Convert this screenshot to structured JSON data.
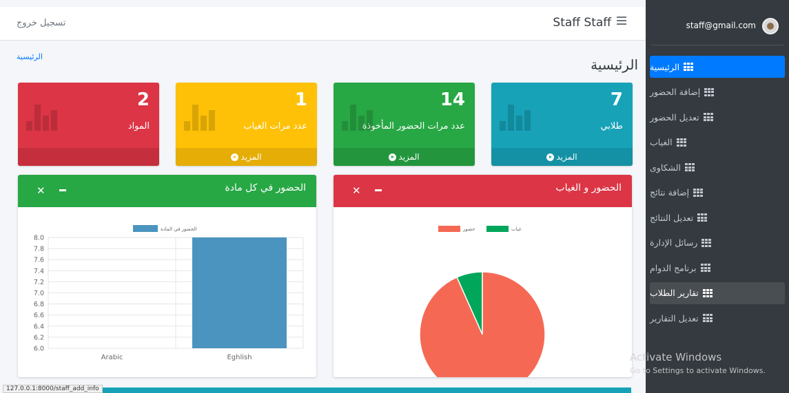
{
  "navbar": {
    "logout_label": "تسجيل خروج",
    "user_name": "Staff Staff",
    "menu_icon": "hamburger-icon"
  },
  "sidebar": {
    "email": "staff@gmail.com",
    "items": [
      {
        "label": "الرئيسية",
        "state": "active"
      },
      {
        "label": "إضافة الحضور",
        "state": ""
      },
      {
        "label": "تعديل الحضور",
        "state": ""
      },
      {
        "label": "الغياب",
        "state": ""
      },
      {
        "label": "الشكاوى",
        "state": ""
      },
      {
        "label": "إضافة نتائج",
        "state": ""
      },
      {
        "label": "تعديل النتائج",
        "state": ""
      },
      {
        "label": "رسائل الإدارة",
        "state": ""
      },
      {
        "label": "برنامج الدوام",
        "state": ""
      },
      {
        "label": "تقارير الطلاب",
        "state": "hover"
      },
      {
        "label": "تعديل التقارير",
        "state": ""
      }
    ]
  },
  "header": {
    "title": "الرئيسية",
    "breadcrumb": "الرئيسية"
  },
  "boxes": [
    {
      "value": "7",
      "label": "طلابي",
      "more": "المزيد",
      "color": "#17a2b8"
    },
    {
      "value": "14",
      "label": "عدد مرات الحضور المأخوذة",
      "more": "المزيد",
      "color": "#28a745"
    },
    {
      "value": "1",
      "label": "عدد مرات الغياب",
      "more": "المزيد",
      "color": "#ffc107"
    },
    {
      "value": "2",
      "label": "المواد",
      "more": "",
      "color": "#dc3545"
    }
  ],
  "cards": {
    "attendance_absence": {
      "title": "الحضور و الغياب",
      "color": "#dc3545"
    },
    "attendance_per_subject": {
      "title": "الحضور في كل مادة",
      "color": "#28a745"
    }
  },
  "chart_data": [
    {
      "type": "pie",
      "legend_position": "top",
      "series": [
        {
          "name": "غياب",
          "values": [
            1
          ],
          "color": "#00a65a"
        },
        {
          "name": "حضور",
          "values": [
            14
          ],
          "color": "#f56954"
        }
      ]
    },
    {
      "type": "bar",
      "categories": [
        "Arabic",
        "Eghlish"
      ],
      "series": [
        {
          "name": "الحضور في المادة",
          "values": [
            null,
            8
          ],
          "color": "#4b94c0"
        }
      ],
      "ylim": [
        6.0,
        8.0
      ],
      "yticks": [
        "8.0",
        "7.8",
        "7.6",
        "7.4",
        "7.2",
        "7.0",
        "6.8",
        "6.6",
        "6.4",
        "6.2",
        "6.0"
      ],
      "legend_position": "top",
      "grid": true
    }
  ],
  "status_url": "127.0.0.1:8000/staff_add_info",
  "watermark": {
    "line1": "Activate Windows",
    "line2": "Go to Settings to activate Windows."
  },
  "bottom_strip_color": "#17a2b8"
}
